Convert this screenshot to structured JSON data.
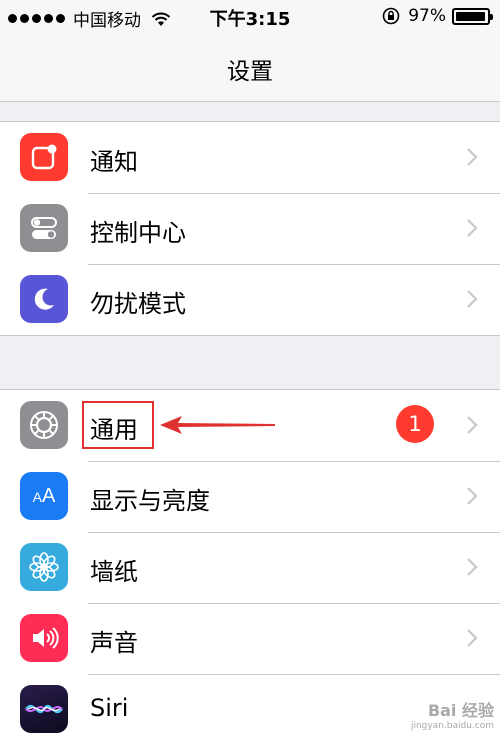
{
  "status_bar": {
    "carrier": "中国移动",
    "time": "下午3:15",
    "battery_percent": "97%",
    "battery_level": 0.97
  },
  "nav": {
    "title": "设置"
  },
  "groups": [
    {
      "items": [
        {
          "label": "通知",
          "icon": "notifications-icon",
          "color": "#ff3b30"
        },
        {
          "label": "控制中心",
          "icon": "control-center-icon",
          "color": "#8e8e93"
        },
        {
          "label": "勿扰模式",
          "icon": "moon-icon",
          "color": "#5856d6"
        }
      ]
    },
    {
      "items": [
        {
          "label": "通用",
          "icon": "gear-icon",
          "color": "#8e8e93",
          "badge": "1"
        },
        {
          "label": "显示与亮度",
          "icon": "display-brightness-icon",
          "color": "#1a7cf5"
        },
        {
          "label": "墙纸",
          "icon": "wallpaper-icon",
          "color": "#36aadc"
        },
        {
          "label": "声音",
          "icon": "sound-icon",
          "color": "#ff2d55"
        },
        {
          "label": "Siri",
          "icon": "siri-icon",
          "color": "#1c1c3c"
        }
      ]
    }
  ],
  "annotation_color": "#e03030",
  "watermark": {
    "brand": "Bai 经验",
    "url": "jingyan.baidu.com"
  }
}
